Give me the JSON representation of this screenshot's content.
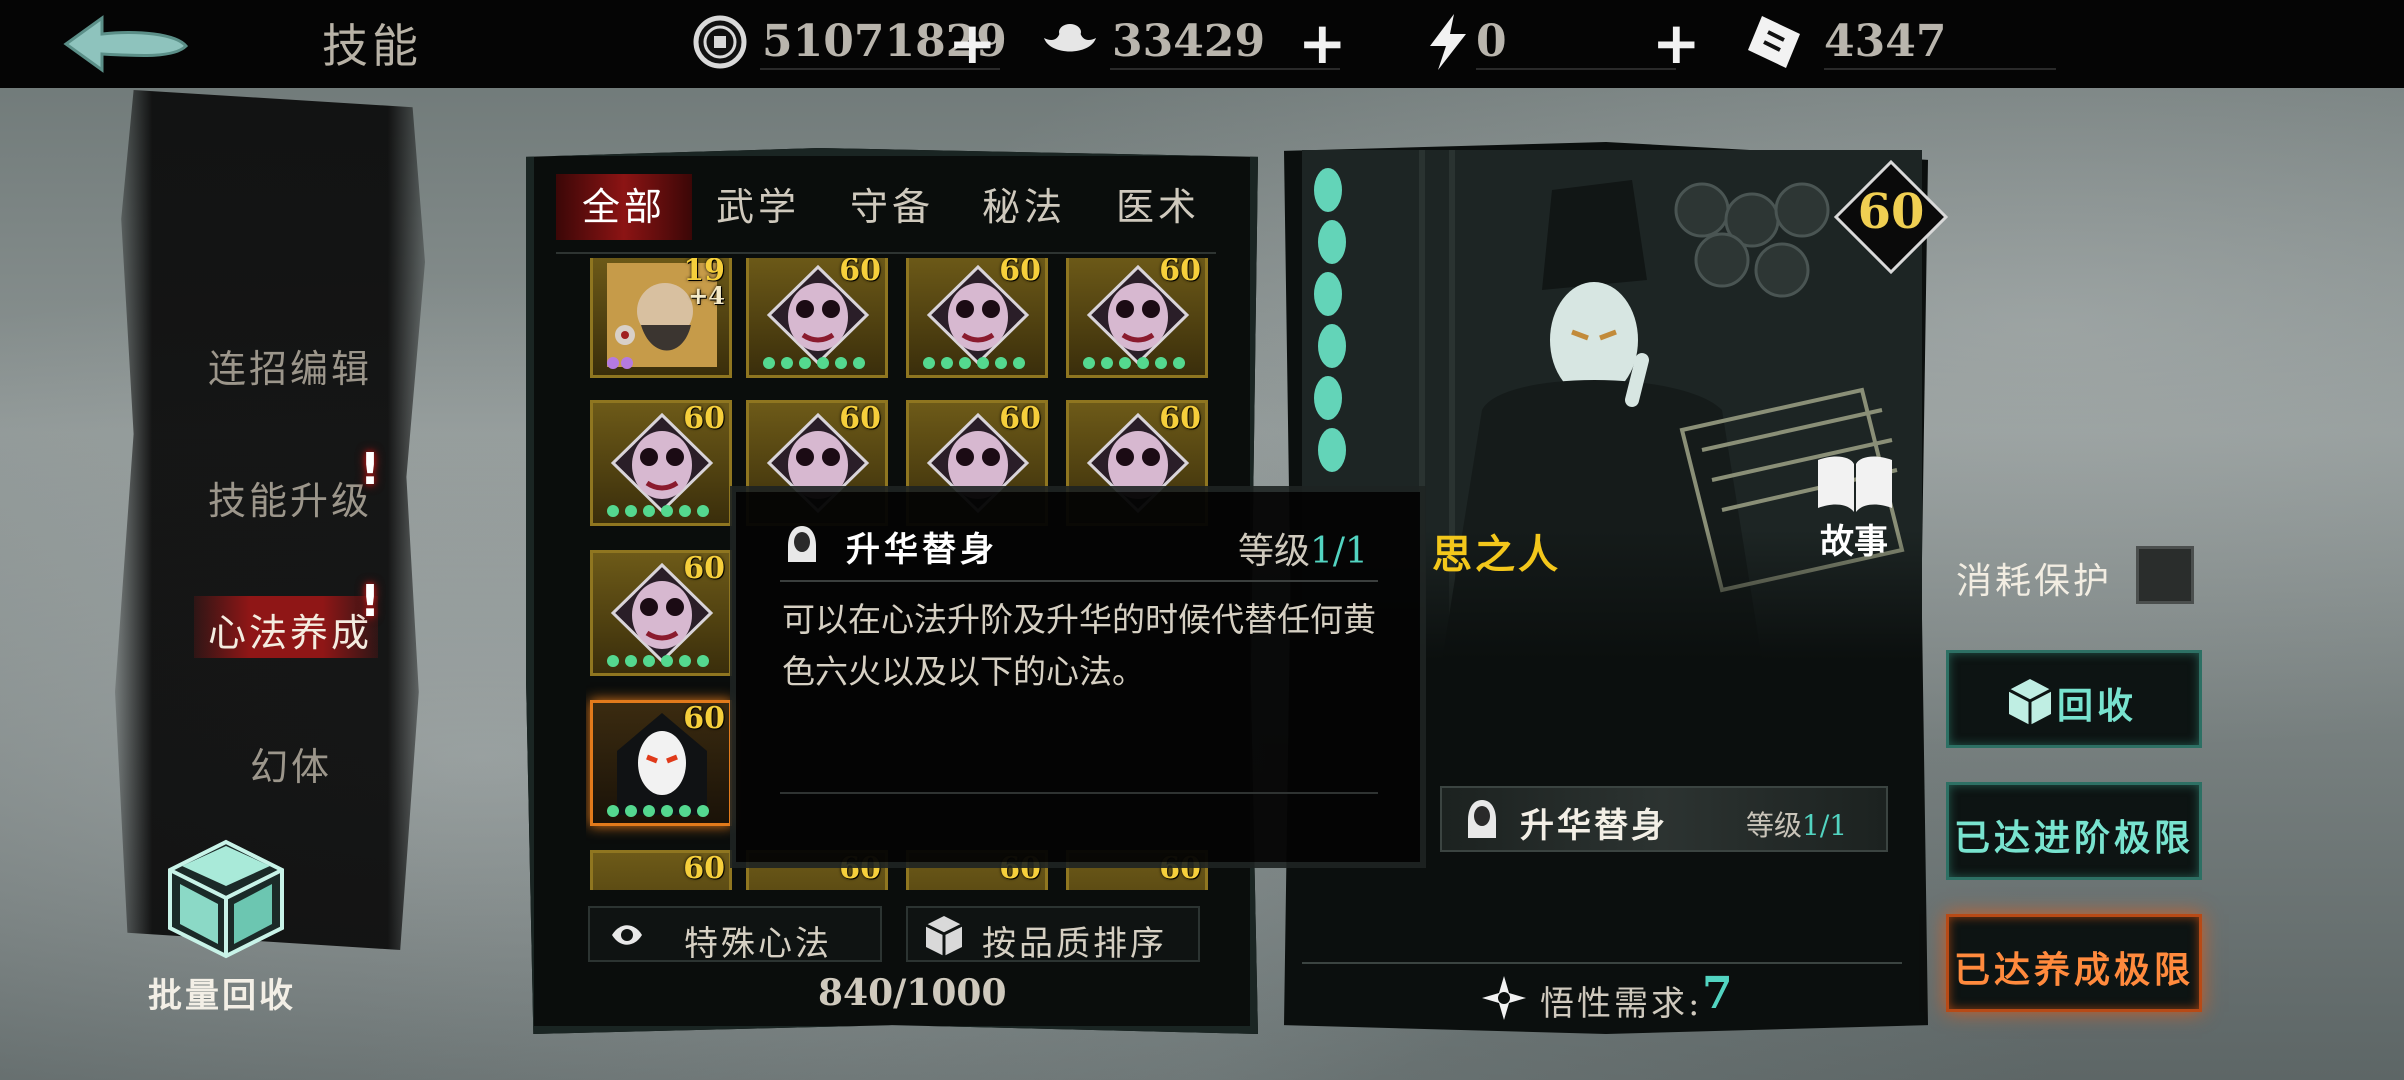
{
  "header": {
    "title": "技能",
    "currencies": [
      {
        "icon": "coin-icon",
        "value": "51071829"
      },
      {
        "icon": "silver-ingot-icon",
        "value": "33429"
      },
      {
        "icon": "lightning-icon",
        "value": "0"
      },
      {
        "icon": "ticket-icon",
        "value": "4347"
      }
    ]
  },
  "sidebar": {
    "items": [
      {
        "label": "连招编辑",
        "alert": false
      },
      {
        "label": "技能升级",
        "alert": true
      },
      {
        "label": "心法养成",
        "alert": true,
        "active": true
      },
      {
        "label": "幻体",
        "alert": false
      }
    ],
    "alert_mark": "!",
    "batch_recycle": "批量回收"
  },
  "tabs": [
    "全部",
    "武学",
    "守备",
    "秘法",
    "医术"
  ],
  "grid": {
    "rows": [
      [
        "19",
        "60",
        "60",
        "60"
      ],
      [
        "60",
        "60",
        "60",
        "60"
      ],
      [
        "60"
      ],
      [
        "60"
      ],
      [
        "60",
        "60",
        "60",
        "60"
      ]
    ],
    "first_card_bonus": "+4"
  },
  "list_footer": {
    "special_label": "特殊心法",
    "sort_label": "按品质排序",
    "count": "840/1000"
  },
  "detail": {
    "level": "60",
    "hero_name": "思之人",
    "story_label": "故事",
    "skill_name": "升华替身",
    "skill_level_prefix": "等级",
    "skill_level": "1/1",
    "wisdom_label": "悟性需求:",
    "wisdom_value": "7"
  },
  "tooltip": {
    "title": "升华替身",
    "level_prefix": "等级",
    "level": "1/1",
    "description": "可以在心法升阶及升华的时候代替任何黄色六火以及以下的心法。"
  },
  "actions": {
    "protect_label": "消耗保护",
    "recycle": "回收",
    "advance_max": "已达进阶极限",
    "cultivate_max": "已达养成极限"
  },
  "colors": {
    "accent_teal": "#52d4c1",
    "gold": "#f3c71b",
    "tab_red": "#8c1414",
    "warn_orange": "#ff8a3d"
  }
}
